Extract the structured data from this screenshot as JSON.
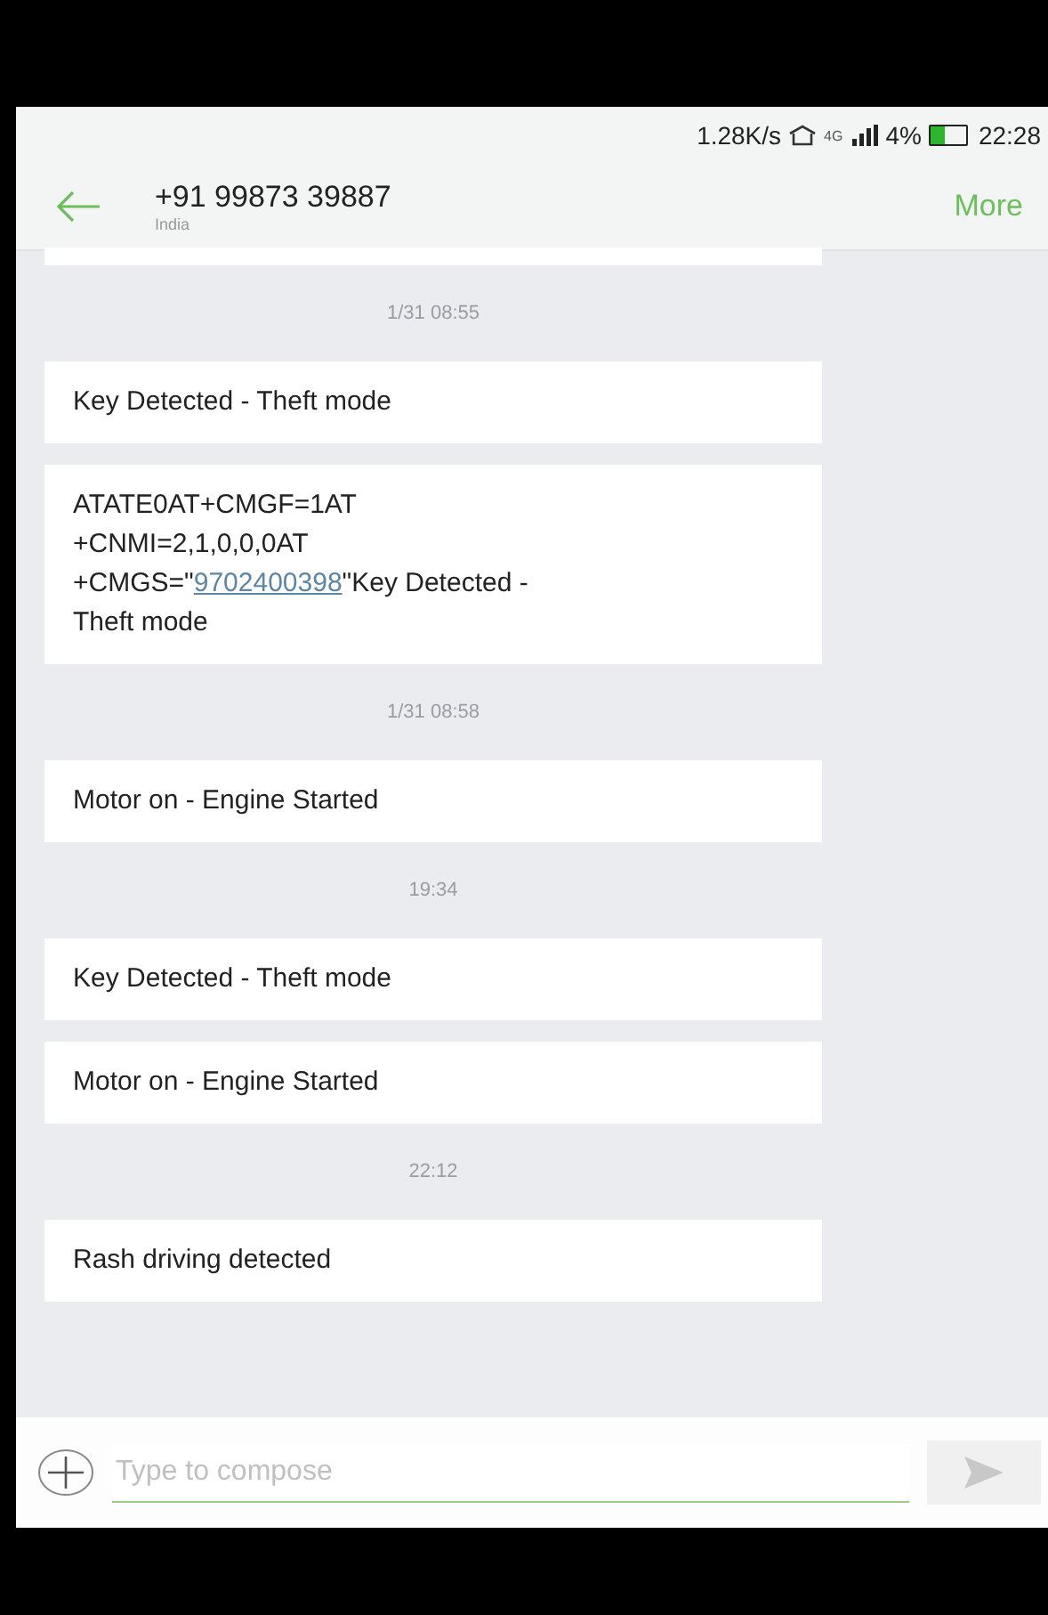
{
  "status_bar": {
    "speed": "1.28K/s",
    "network": "4G",
    "battery_text": "4%",
    "time": "22:28"
  },
  "header": {
    "title": "+91 99873 39887",
    "subtitle": "India",
    "action": "More"
  },
  "messages": [
    {
      "kind": "cut"
    },
    {
      "kind": "time",
      "text": "1/31 08:55"
    },
    {
      "kind": "message",
      "parts": [
        {
          "text": "Key Detected - Theft mode",
          "kind": "text"
        }
      ]
    },
    {
      "kind": "message",
      "parts": [
        {
          "text": "ATATE0AT+CMGF=1AT\n+CNMI=2,1,0,0,0AT\n+CMGS=\"",
          "kind": "text"
        },
        {
          "text": "9702400398",
          "kind": "link"
        },
        {
          "text": "\"Key Detected - Theft mode",
          "kind": "text"
        }
      ]
    },
    {
      "kind": "time",
      "text": "1/31 08:58"
    },
    {
      "kind": "message",
      "parts": [
        {
          "text": "Motor on - Engine Started",
          "kind": "text"
        }
      ]
    },
    {
      "kind": "time",
      "text": "19:34"
    },
    {
      "kind": "message",
      "parts": [
        {
          "text": "Key Detected - Theft mode",
          "kind": "text"
        }
      ]
    },
    {
      "kind": "message",
      "parts": [
        {
          "text": "Motor on - Engine Started",
          "kind": "text"
        }
      ]
    },
    {
      "kind": "time",
      "text": "22:12"
    },
    {
      "kind": "message",
      "parts": [
        {
          "text": "Rash driving detected",
          "kind": "text"
        }
      ]
    }
  ],
  "compose": {
    "placeholder": "Type to compose"
  }
}
